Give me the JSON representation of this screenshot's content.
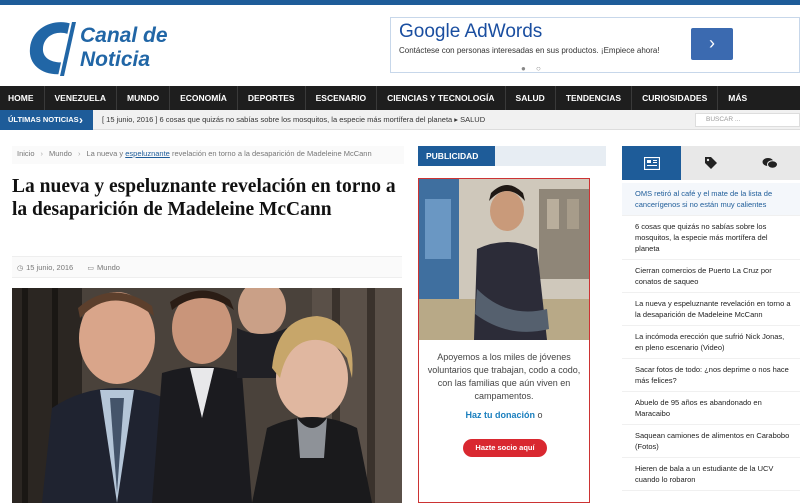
{
  "header": {
    "logo_line1": "Canal de",
    "logo_line2": "Noticia"
  },
  "ad": {
    "title": "Google AdWords",
    "text": "Contáctese con personas interesadas en sus productos. ¡Empiece ahora!",
    "button_glyph": "›",
    "dots": "● ○"
  },
  "nav": {
    "items": [
      "HOME",
      "VENEZUELA",
      "MUNDO",
      "ECONOMÍA",
      "DEPORTES",
      "ESCENARIO",
      "CIENCIAS Y TECNOLOGÍA",
      "SALUD",
      "TENDENCIAS",
      "CURIOSIDADES",
      "MÁS"
    ]
  },
  "breaking": {
    "label": "ÚLTIMAS NOTICIAS",
    "text": "[ 15 junio, 2016 ]  6 cosas que quizás no sabías sobre los mosquitos, la especie más mortífera del planeta  ▸ SALUD",
    "search_placeholder": "BUSCAR ..."
  },
  "breadcrumb": {
    "home": "Inicio",
    "section": "Mundo",
    "current_prefix": "La nueva y ",
    "current_link": "espeluznante",
    "current_suffix": " revelación en torno a la desaparición de Madeleine McCann"
  },
  "article": {
    "title": "La nueva y espeluznante revelación en torno a la desaparición de Madeleine McCann",
    "date": "15 junio, 2016",
    "category": "Mundo"
  },
  "publicidad": {
    "label": "PUBLICIDAD",
    "text": "Apoyemos a los miles de jóvenes voluntarios que trabajan, codo a codo, con las familias que aún viven en campamentos.",
    "link_bold": "Haz tu donación",
    "link_tail": " o",
    "button": "Hazte socio aquí"
  },
  "sidebar": {
    "tab_icons": [
      "newspaper-icon",
      "tag-icon",
      "comments-icon"
    ],
    "items": [
      "OMS retiró al café y el mate de la lista de cancerígenos si no están muy calientes",
      "6 cosas que quizás no sabías sobre los mosquitos, la especie más mortífera del planeta",
      "Cierran comercios de Puerto La Cruz por conatos de saqueo",
      "La nueva y espeluznante revelación en torno a la desaparición de Madeleine McCann",
      "La incómoda erección que sufrió Nick Jonas, en pleno escenario (Video)",
      "Sacar fotos de todo: ¿nos deprime o nos hace más felices?",
      "Abuelo de 95 años es abandonado en Maracaibo",
      "Saquean camiones de alimentos en Carabobo (Fotos)",
      "Hieren de bala a un estudiante de la UCV cuando lo robaron"
    ]
  },
  "colors": {
    "brand_blue": "#1e5c99",
    "nav_bg": "#1e1e1e",
    "donate_red": "#d92830"
  }
}
